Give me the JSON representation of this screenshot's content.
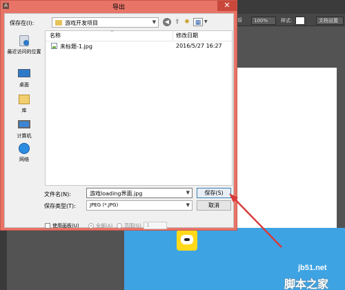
{
  "background_app": {
    "options_bar": {
      "zoom_value": "100%",
      "style_label": "样式:",
      "doc_button": "文档设置"
    },
    "left_edge_partial": "设"
  },
  "dialog": {
    "title": "导出",
    "app_icon_letter": "A",
    "close_glyph": "✕",
    "save_in_label": "保存在(I):",
    "save_in_value": "游戏开发项目",
    "places": [
      {
        "label": "最近访问的位置",
        "icon": "recent-places-icon"
      },
      {
        "label": "桌面",
        "icon": "desktop-icon"
      },
      {
        "label": "库",
        "icon": "libraries-icon"
      },
      {
        "label": "计算机",
        "icon": "computer-icon"
      },
      {
        "label": "网络",
        "icon": "network-icon"
      }
    ],
    "columns": {
      "name": "名称",
      "date": "修改日期"
    },
    "files": [
      {
        "name": "未标题-1.jpg",
        "date": "2016/5/27 16:27"
      }
    ],
    "file_name_label": "文件名(N):",
    "file_name_value": "游戏loading界面.jpg",
    "file_type_label": "保存类型(T):",
    "file_type_value": "JPEG (*.JPG)",
    "save_button": "保存(S)",
    "cancel_button": "取消",
    "use_artboards_label": "使用画板(U)",
    "all_label": "全部(A)",
    "range_label": "范围(G)",
    "range_value": "1"
  },
  "watermark": {
    "line1": "jb51.net",
    "line2": "脚本之家"
  },
  "colors": {
    "dialog_frame": "#e87468",
    "close_button": "#c9483b",
    "arrow": "#d93a3a",
    "canvas_blue": "#3ea3e3",
    "icon_yellow": "#ffd91a"
  }
}
